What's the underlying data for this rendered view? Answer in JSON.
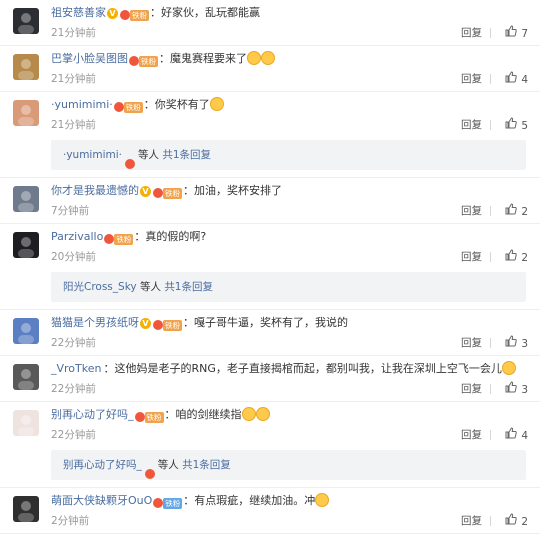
{
  "ui": {
    "reply_label": "回复",
    "thumb_icon": "thumbs-up-icon"
  },
  "comments": [
    {
      "user": "祖安慈善家",
      "vip": true,
      "fan_label": "铁粉",
      "fan_style": "iron",
      "text": "好家伙，乱玩都能赢",
      "emoji_count": 0,
      "time": "21分钟前",
      "likes": "7",
      "avatar_color": "#2c2e33"
    },
    {
      "user": "巴掌小脸吴图图",
      "vip": false,
      "fan_label": "铁粉",
      "fan_style": "iron",
      "text": "魔鬼赛程要来了",
      "emoji_count": 2,
      "time": "21分钟前",
      "likes": "4",
      "avatar_color": "#b58a4a"
    },
    {
      "user": "·yumimimi·",
      "vip": false,
      "fan_label": "铁粉",
      "fan_style": "iron",
      "text": "你奖杯有了",
      "emoji_count": 1,
      "time": "21分钟前",
      "likes": "5",
      "avatar_color": "#d99a78",
      "reply": {
        "name": "·yumimimi·",
        "etc": "等人",
        "count": "共1条回复"
      }
    },
    {
      "user": "你才是我最遗憾的",
      "vip": true,
      "fan_label": "铁粉",
      "fan_style": "iron",
      "text": "加油，奖杯安排了",
      "emoji_count": 0,
      "time": "7分钟前",
      "likes": "2",
      "avatar_color": "#6f7b8c"
    },
    {
      "user": "Parzivallo",
      "vip": false,
      "fan_label": "铁粉",
      "fan_style": "iron",
      "text": "真的假的啊?",
      "emoji_count": 0,
      "time": "20分钟前",
      "likes": "2",
      "avatar_color": "#1e1e22",
      "reply": {
        "name": "阳光Cross_Sky",
        "etc": "等人",
        "count": "共1条回复"
      }
    },
    {
      "user": "猫猫是个男孩纸呀",
      "vip": true,
      "fan_label": "铁粉",
      "fan_style": "iron",
      "text": "嘎子哥牛逼，奖杯有了，我说的",
      "emoji_count": 0,
      "time": "22分钟前",
      "likes": "3",
      "avatar_color": "#5b7fc2"
    },
    {
      "user": "_VroTken",
      "vip": false,
      "fan_label": "",
      "fan_style": "",
      "text": "这他妈是老子的RNG，老子直接揭棺而起，都别叫我，让我在深圳上空飞一会儿",
      "emoji_count": 1,
      "time": "22分钟前",
      "likes": "3",
      "avatar_color": "#595959"
    },
    {
      "user": "别再心动了好吗_",
      "vip": false,
      "fan_label": "铁粉",
      "fan_style": "iron",
      "text": "咱的剑继续指",
      "emoji_count": 2,
      "time": "22分钟前",
      "likes": "4",
      "avatar_color": "#efe3e0",
      "reply": {
        "name": "别再心动了好吗_",
        "etc": "等人",
        "count": "共1条回复"
      }
    },
    {
      "user": "萌面大侠缺颗牙OuO",
      "vip": false,
      "fan_label": "铁粉",
      "fan_style": "iron-blue",
      "text": "有点瑕疵，继续加油。冲",
      "emoji_count": 1,
      "time": "2分钟前",
      "likes": "2",
      "avatar_color": "#2f2f2f"
    }
  ]
}
